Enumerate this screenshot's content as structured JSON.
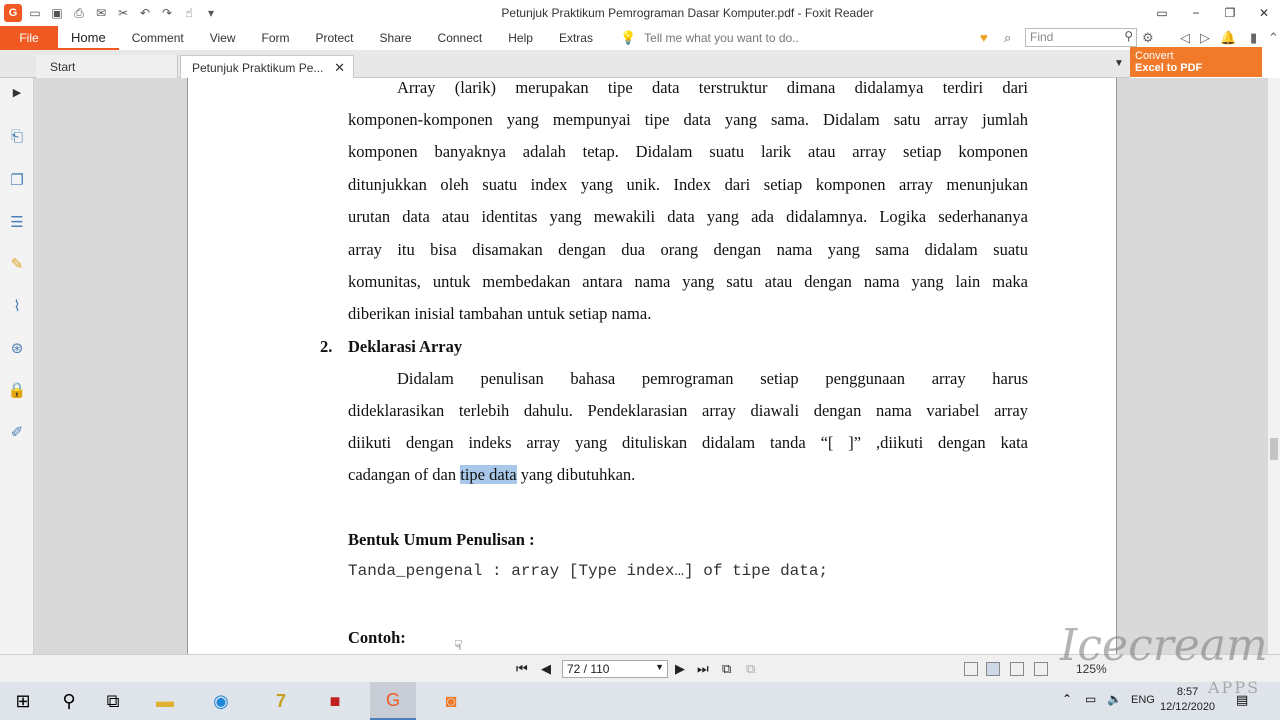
{
  "window": {
    "title": "Petunjuk Praktikum Pemrograman Dasar Komputer.pdf - Foxit Reader",
    "controls": [
      "▭",
      "−",
      "❐",
      "✕"
    ]
  },
  "ribbon": {
    "file_label": "File",
    "tabs": [
      "Home",
      "Comment",
      "View",
      "Form",
      "Protect",
      "Share",
      "Connect",
      "Help",
      "Extras"
    ],
    "active_tab": "Home",
    "tell_me_placeholder": "Tell me what you want to do..",
    "find_placeholder": "Find"
  },
  "convert_button": {
    "line1": "Convert",
    "line2": "Excel to PDF"
  },
  "doc_tabs": {
    "start_label": "Start",
    "doc_label": "Petunjuk Praktikum Pe..."
  },
  "document": {
    "para1_lines": [
      "Array (larik) merupakan tipe data terstruktur dimana didalamya terdiri dari",
      "komponen-komponen yang mempunyai tipe data yang sama. Didalam satu array jumlah",
      "komponen banyaknya adalah tetap. Didalam suatu larik atau array setiap komponen",
      "ditunjukkan oleh suatu index yang unik. Index dari setiap komponen array menunjukan",
      "urutan data atau identitas yang mewakili data yang ada didalamnya. Logika sederhananya",
      "array itu bisa disamakan dengan dua orang dengan nama yang sama didalam suatu",
      "komunitas, untuk membedakan antara nama yang satu atau dengan nama yang lain maka",
      "diberikan inisial tambahan untuk setiap nama."
    ],
    "section_number": "2.",
    "section_title": "Deklarasi Array",
    "para2_lines": [
      "Didalam penulisan bahasa pemrograman setiap penggunaan array harus",
      "dideklarasikan terlebih dahulu. Pendeklarasian array diawali dengan nama variabel array",
      "diikuti dengan indeks array yang dituliskan didalam tanda “[ ]” ,diikuti dengan kata"
    ],
    "para2_last_before": "cadangan of dan ",
    "para2_last_highlight": "tipe data",
    "para2_last_after": " yang dibutuhkan.",
    "general_form_heading": "Bentuk Umum Penulisan :",
    "code_line": "Tanda_pengenal : array [Type index…] of tipe data;",
    "example_heading": "Contoh:"
  },
  "statusbar": {
    "page_indicator": "72 / 110",
    "zoom": "125%"
  },
  "taskbar": {
    "language": "ENG",
    "time": "8:57",
    "date": "12/12/2020"
  },
  "watermark": {
    "text": "Icecream",
    "sub": "APPS"
  },
  "colors": {
    "accent": "#f05a22",
    "highlight": "#a9c7e8",
    "viewer_bg": "#d9d9d9"
  }
}
